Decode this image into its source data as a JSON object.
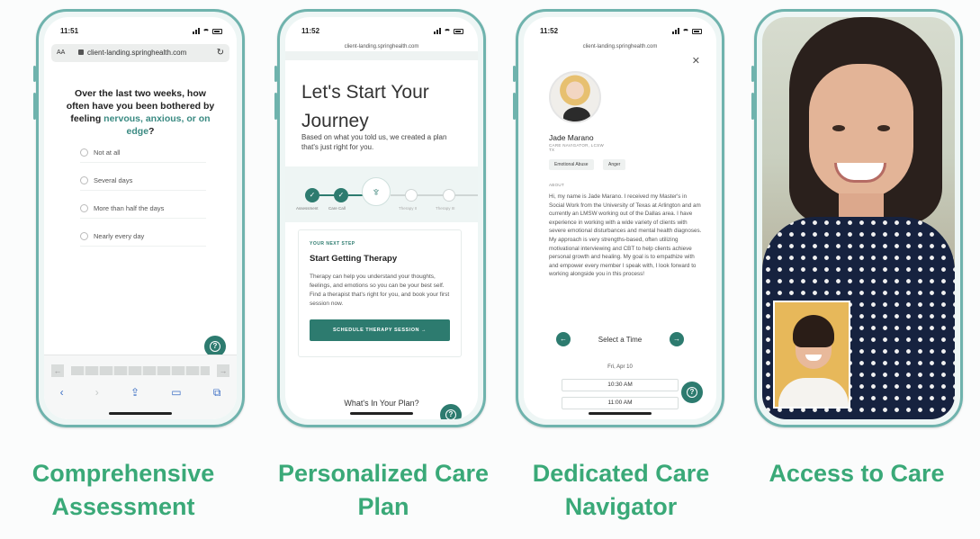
{
  "phone1": {
    "time": "11:51",
    "text_size": "AA",
    "url": "client-landing.springhealth.com",
    "question_start": "Over the last two weeks, how often have you been bothered by feeling",
    "question_highlight": "nervous, anxious, or on edge",
    "question_end": "?",
    "options": [
      "Not at all",
      "Several days",
      "More than half the days",
      "Nearly every day"
    ],
    "caption": "Comprehensive Assessment"
  },
  "phone2": {
    "time": "11:52",
    "url": "client-landing.springhealth.com",
    "title": "Let's Start Your Journey",
    "subtitle": "Based on what you told us, we created a plan that's just right for you.",
    "steps": [
      "Assessment",
      "Care Call",
      "Therapy II",
      "Therapy III"
    ],
    "next_step_label": "YOUR NEXT STEP",
    "card_title": "Start Getting Therapy",
    "card_body": "Therapy can help you understand your thoughts, feelings, and emotions so you can be your best self. Find a therapist that's right for you, and book your first session now.",
    "cta": "SCHEDULE THERAPY SESSION",
    "plan_heading": "What's In Your Plan?",
    "caption": "Personalized Care Plan"
  },
  "phone3": {
    "time": "11:52",
    "url": "client-landing.springhealth.com",
    "name": "Jade Marano",
    "role": "CARE NAVIGATOR, LCSW",
    "state": "TX",
    "tags": [
      "Emotional Abuse",
      "Anger"
    ],
    "about_label": "ABOUT",
    "about": "Hi, my name is Jade Marano. I received my Master's in Social Work from the University of Texas at Arlington and am currently an LMSW working out of the Dallas area. I have experience in working with a wide variety of clients with severe emotional disturbances and mental health diagnoses. My approach is very strengths-based, often utilizing motivational interviewing and CBT to help clients achieve personal growth and healing. My goal is to empathize with and empower every member I speak with, I look forward to working alongside you in this process!",
    "select_time": "Select a Time",
    "date": "Fri, Apr 10",
    "slots": [
      "10:30 AM",
      "11:00 AM"
    ],
    "caption": "Dedicated Care Navigator"
  },
  "phone4": {
    "caption": "Access to Care"
  },
  "colors": {
    "brand_green": "#2d7b6f",
    "caption_green": "#3aa978",
    "phone_frame": "#6fb3ad"
  }
}
